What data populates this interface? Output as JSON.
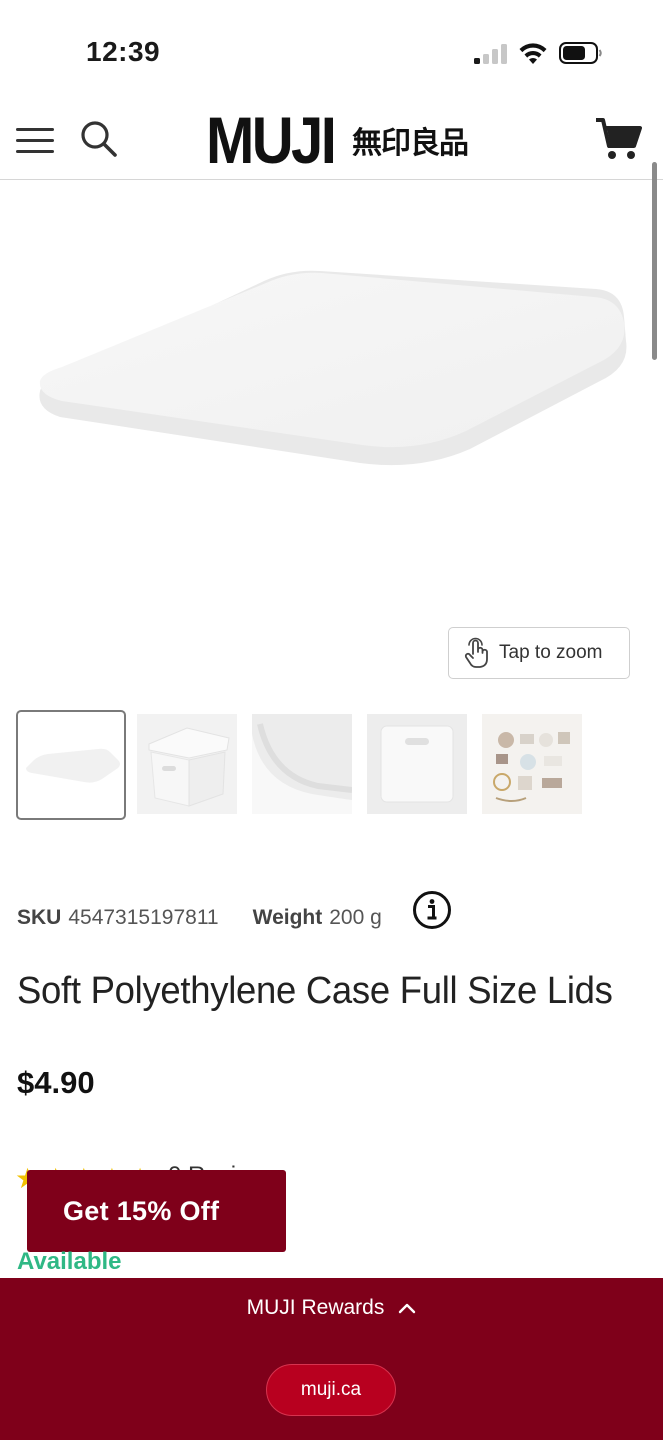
{
  "status_bar": {
    "time": "12:39"
  },
  "header": {
    "logo_text": "MUJI",
    "logo_subtext": "無印良品",
    "icons": [
      "menu-icon",
      "search-icon",
      "cart-icon"
    ]
  },
  "gallery": {
    "zoom_label": "Tap to zoom",
    "thumbnail_count": 5,
    "selected_index": 0
  },
  "product": {
    "sku_label": "SKU",
    "sku_value": "4547315197811",
    "weight_label": "Weight",
    "weight_value": "200 g",
    "title": "Soft Polyethylene Case Full Size Lids",
    "price": "$4.90",
    "reviews_text": "0 Reviews",
    "availability": "Available"
  },
  "promo": {
    "label": "Get 15% Off"
  },
  "rewards": {
    "label": "MUJI Rewards",
    "domain": "muji.ca"
  },
  "colors": {
    "brand": "#7f001a",
    "pill": "#b8001f",
    "available": "#2fb885",
    "star": "#f2c100"
  }
}
